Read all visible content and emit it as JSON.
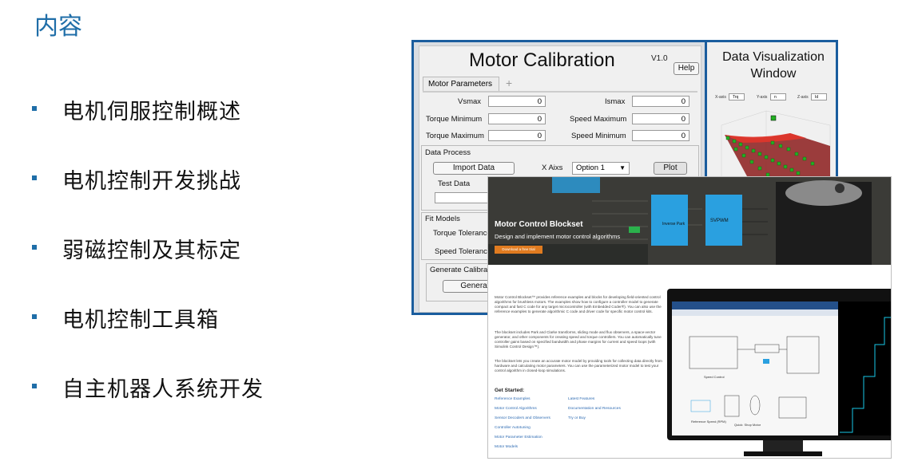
{
  "slide": {
    "title": "内容",
    "items": [
      "电机伺服控制概述",
      "电机控制开发挑战",
      "弱磁控制及其标定",
      "电机控制工具箱",
      "自主机器人系统开发"
    ]
  },
  "app": {
    "title": "Motor Calibration",
    "version": "V1.0",
    "help": "Help",
    "tab": "Motor Parameters",
    "tab_add": "+",
    "params": {
      "vsmax_label": "Vsmax",
      "vsmax": "0",
      "ismax_label": "Ismax",
      "ismax": "0",
      "tmin_label": "Torque Minimum",
      "tmin": "0",
      "smax_label": "Speed Maximum",
      "smax": "0",
      "tmax_label": "Torque Maximum",
      "tmax": "0",
      "smin_label": "Speed Minimum",
      "smin": "0"
    },
    "data_process": {
      "title": "Data Process",
      "import": "Import Data",
      "xaxis_label": "X Aixs",
      "xaxis_value": "Option 1",
      "plot": "Plot",
      "test_data": "Test Data"
    },
    "fit": {
      "title": "Fit Models",
      "torque_tol": "Torque Tolerance",
      "speed_tol": "Speed Tolerance"
    },
    "gen": {
      "title": "Generate Calibration",
      "button": "Generate Calib"
    },
    "viz": {
      "title": "Data Visualization Window",
      "xaxis": "X-axis",
      "xval": "Trq",
      "yaxis": "Y-axis",
      "yval": "n",
      "zaxis": "Z-axis",
      "zval": "Id"
    }
  },
  "web": {
    "hero_title": "Motor Control Blockset",
    "hero_subtitle": "Design and implement motor control algorithms",
    "hero_button": "Download a free trial",
    "para1": "Motor Control Blockset™ provides reference examples and blocks for developing field-oriented control algorithms for brushless motors. The examples show how to configure a controller model to generate compact and fast C code for any target microcontroller (with Embedded Coder®). You can also use the reference examples to generate algorithmic C code and driver code for specific motor control kits.",
    "para2": "The blockset includes Park and Clarke transforms, sliding mode and flux observers, a space-vector generator, and other components for creating speed and torque controllers. You can automatically tune controller gains based on specified bandwidth and phase margins for current and speed loops (with Simulink Control Design™).",
    "para3": "The blockset lets you create an accurate motor model by providing tools for collecting data directly from hardware and calculating motor parameters. You can use the parameterized motor model to test your control algorithm in closed-loop simulations.",
    "get_started": "Get Started:",
    "links_left": [
      "Reference Examples",
      "Motor Control Algorithms",
      "Sensor Decoders and Observers",
      "Controller Autotuning",
      "Motor Parameter Estimation",
      "Motor Models"
    ],
    "links_right": [
      "Latest Features",
      "Documentation and Resources",
      "Try or Buy"
    ],
    "diagram_labels": {
      "inverse_park": "Inverse Park",
      "svpwm": "SVPWM",
      "speed_control": "Speed Control",
      "ref_speed": "Reference Speed (RPM)",
      "plant": "Quick: Shop Motor"
    }
  },
  "colors": {
    "accent": "#1f6ea8",
    "app_border": "#1a5d9e",
    "hero_button": "#e07b20",
    "block": "#2aa0e0"
  }
}
